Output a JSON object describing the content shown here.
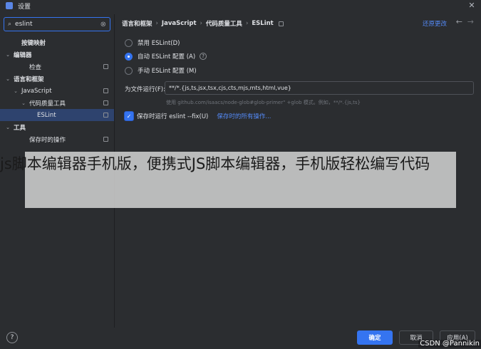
{
  "window": {
    "title": "设置"
  },
  "sidebar": {
    "search_value": "eslint",
    "items": [
      {
        "label": "按键映射",
        "depth": 1,
        "bold": true,
        "chevron": "",
        "pin": false,
        "selected": false
      },
      {
        "label": "编辑器",
        "depth": 0,
        "bold": true,
        "chevron": "v",
        "pin": false,
        "selected": false
      },
      {
        "label": "检查",
        "depth": 2,
        "bold": false,
        "chevron": "",
        "pin": true,
        "selected": false
      },
      {
        "label": "语言和框架",
        "depth": 0,
        "bold": true,
        "chevron": "v",
        "pin": false,
        "selected": false
      },
      {
        "label": "JavaScript",
        "depth": 1,
        "bold": false,
        "chevron": "v",
        "pin": true,
        "selected": false
      },
      {
        "label": "代码质量工具",
        "depth": 2,
        "bold": false,
        "chevron": "v",
        "pin": true,
        "selected": false
      },
      {
        "label": "ESLint",
        "depth": 3,
        "bold": false,
        "chevron": "",
        "pin": true,
        "selected": true
      },
      {
        "label": "工具",
        "depth": 0,
        "bold": true,
        "chevron": "v",
        "pin": false,
        "selected": false
      },
      {
        "label": "保存时的操作",
        "depth": 2,
        "bold": false,
        "chevron": "",
        "pin": true,
        "selected": false
      }
    ]
  },
  "breadcrumb": [
    "语言和框架",
    "JavaScript",
    "代码质量工具",
    "ESLint"
  ],
  "breadcrumb_sep": "›",
  "header": {
    "reset_label": "还原更改",
    "back_icon": "←",
    "forward_icon": "→"
  },
  "eslint": {
    "options": [
      {
        "label": "禁用 ESLint(D)",
        "selected": false
      },
      {
        "label": "自动 ESLint 配置 (A)",
        "selected": true
      },
      {
        "label": "手动 ESLint 配置 (M)",
        "selected": false
      }
    ],
    "files_label": "为文件运行(F):",
    "files_value": "**/*.{js,ts,jsx,tsx,cjs,cts,mjs,mts,html,vue}",
    "files_hint": "使用 github.com/isaacs/node-glob#glob-primer\" +glob 模式。例如，**/*.{js,ts}",
    "fix_on_save_label": "保存时运行 eslint --fix(U)",
    "fix_on_save_checked": true,
    "actions_link": "保存时的所有操作..."
  },
  "overlay": {
    "text": "js脚本编辑器手机版，便携式JS脚本编辑器，手机版轻松编写代码"
  },
  "footer": {
    "help_label": "?",
    "ok_label": "确定",
    "cancel_label": "取消",
    "apply_label": "应用(A)",
    "watermark": "CSDN @Pannikin"
  }
}
